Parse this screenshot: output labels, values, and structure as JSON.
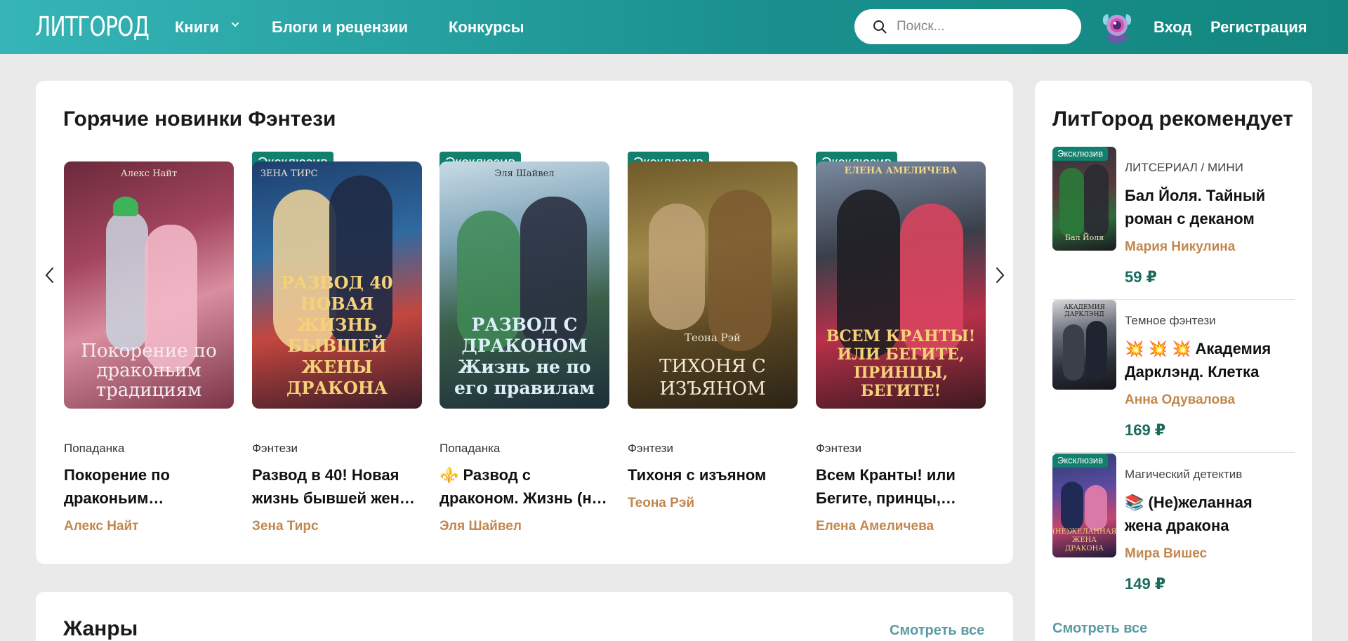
{
  "header": {
    "logo": "ЛИТГОРОД",
    "nav": [
      {
        "label": "Книги"
      },
      {
        "label": "Блоги и рецензии"
      },
      {
        "label": "Конкурсы"
      }
    ],
    "search_placeholder": "Поиск...",
    "login": "Вход",
    "register": "Регистрация",
    "accent": "#1a918f"
  },
  "hot_new": {
    "title": "Горячие новинки Фэнтези",
    "badge_label": "Эксклюзив",
    "books": [
      {
        "genre": "Попаданка",
        "title": "Покорение по драконьим…",
        "author": "Алекс Найт",
        "exclusive": false,
        "cover_author": "Алекс Найт",
        "cover_text": "Покорение по драконьим традициям"
      },
      {
        "genre": "Фэнтези",
        "title": "Развод в 40! Новая жизнь бывшей жен…",
        "author": "Зена Тирс",
        "exclusive": true,
        "cover_author": "ЗЕНА ТИРС",
        "cover_text": "РАЗВОД 40 НОВАЯ ЖИЗНЬ БЫВШЕЙ ЖЕНЫ ДРАКОНА"
      },
      {
        "genre": "Попаданка",
        "title": "⚜️ Развод с драконом. Жизнь (н…",
        "author": "Эля Шайвел",
        "exclusive": true,
        "cover_author": "Эля Шайвел",
        "cover_text": "РАЗВОД С ДРАКОНОМ Жизнь не по его правилам"
      },
      {
        "genre": "Фэнтези",
        "title": "Тихоня с изъяном",
        "author": "Теона Рэй",
        "exclusive": true,
        "cover_author": "Теона Рэй",
        "cover_text": "ТИХОНЯ С ИЗЪЯНОМ"
      },
      {
        "genre": "Фэнтези",
        "title": "Всем Кранты! или Бегите, принцы,…",
        "author": "Елена Амеличева",
        "exclusive": true,
        "cover_author": "ЕЛЕНА АМЕЛИЧЕВА",
        "cover_text": "ВСЕМ КРАНТЫ! ИЛИ БЕГИТЕ, ПРИНЦЫ, БЕГИТЕ!"
      }
    ]
  },
  "genres": {
    "title": "Жанры",
    "see_all": "Смотреть все"
  },
  "recommended": {
    "title": "ЛитГород рекомендует",
    "badge_label": "Эксклюзив",
    "items": [
      {
        "genre": "ЛИТСЕРИАЛ / МИНИ",
        "title": "Бал Йоля. Тайный роман с деканом",
        "author": "Мария Никулина",
        "price": "59 ₽",
        "exclusive": true,
        "cover_text": "Бал Йоля"
      },
      {
        "genre": "Темное фэнтези",
        "title": "💥 💥 💥 Академия Дарклэнд. Клетка",
        "author": "Анна Одувалова",
        "price": "169 ₽",
        "exclusive": false,
        "cover_text": "АКАДЕМИЯ ДАРКЛЭНД"
      },
      {
        "genre": "Магический детектив",
        "title": "📚 (Не)желанная жена дракона",
        "author": "Мира Вишес",
        "price": "149 ₽",
        "exclusive": true,
        "cover_text": "(НЕ)ЖЕЛАННАЯ ЖЕНА ДРАКОНА"
      }
    ],
    "see_all": "Смотреть все"
  }
}
